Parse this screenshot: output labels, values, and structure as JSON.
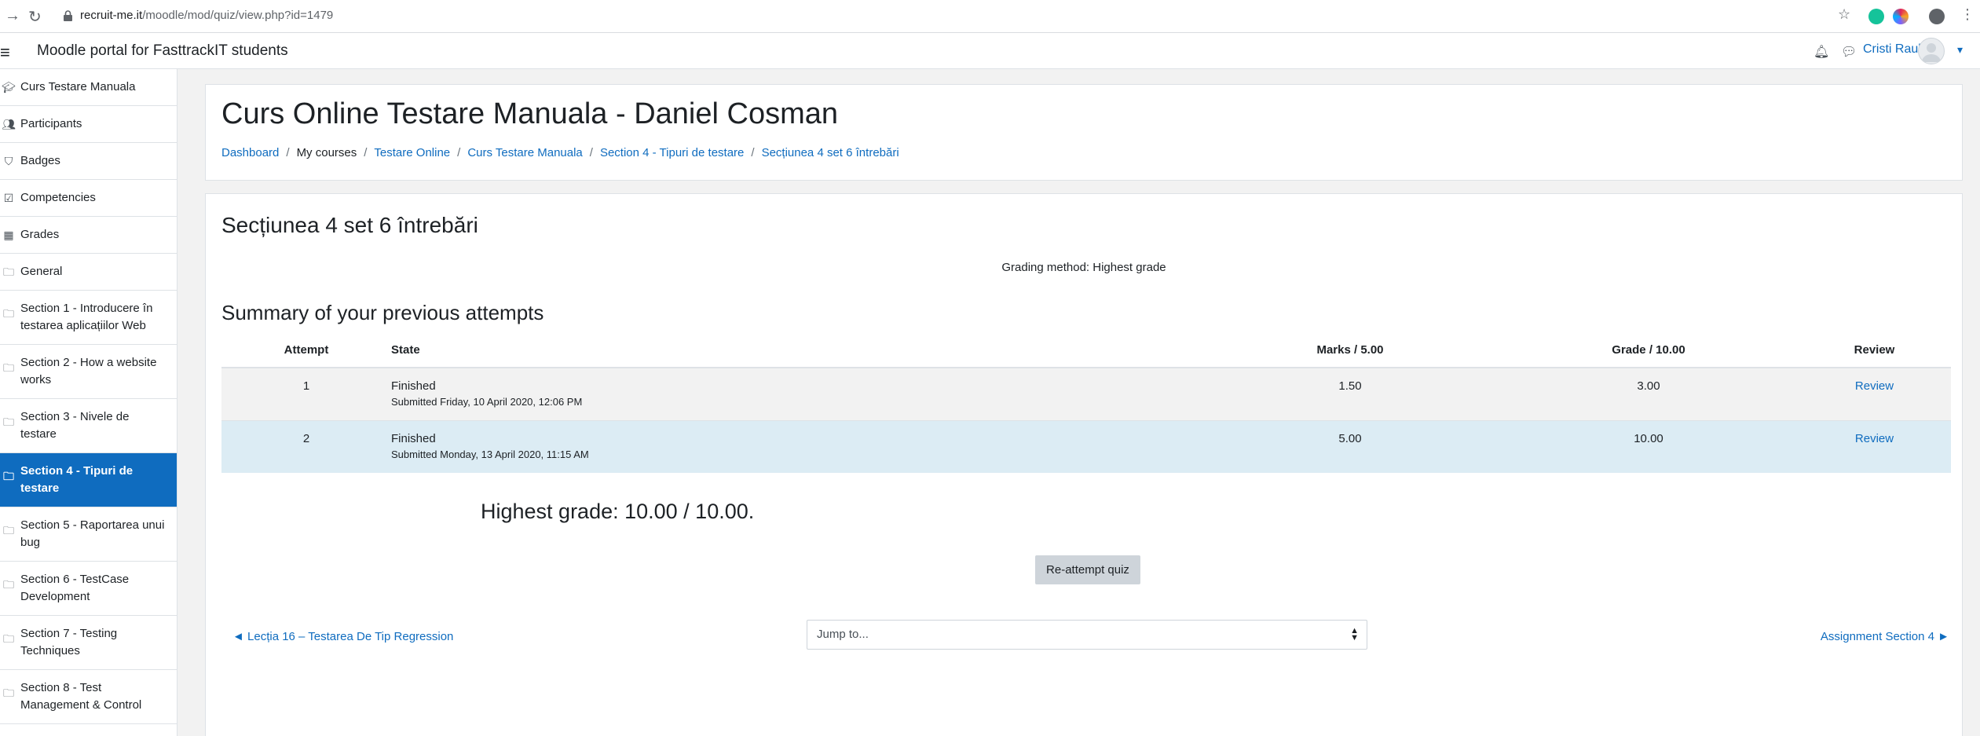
{
  "browser": {
    "url_host": "recruit-me.it",
    "url_path": "/moodle/mod/quiz/view.php?id=1479"
  },
  "navbar": {
    "site_name": "Moodle portal for FasttrackIT students",
    "user_name": "Cristi Raul"
  },
  "sidebar": {
    "items": [
      {
        "label": "Curs Testare Manuala",
        "icon": "graduation-cap-icon"
      },
      {
        "label": "Participants",
        "icon": "users-icon"
      },
      {
        "label": "Badges",
        "icon": "shield-icon"
      },
      {
        "label": "Competencies",
        "icon": "check-square-icon"
      },
      {
        "label": "Grades",
        "icon": "table-icon"
      },
      {
        "label": "General",
        "icon": "folder-icon"
      },
      {
        "label": "Section 1 - Introducere în testarea aplicațiilor Web",
        "icon": "folder-icon"
      },
      {
        "label": "Section 2 - How a website works",
        "icon": "folder-icon"
      },
      {
        "label": "Section 3 - Nivele de testare",
        "icon": "folder-icon"
      },
      {
        "label": "Section 4 - Tipuri de testare",
        "icon": "folder-icon",
        "active": true
      },
      {
        "label": "Section 5 - Raportarea unui bug",
        "icon": "folder-icon"
      },
      {
        "label": "Section 6 - TestCase Development",
        "icon": "folder-icon"
      },
      {
        "label": "Section 7 - Testing Techniques",
        "icon": "folder-icon"
      },
      {
        "label": "Section 8 - Test Management & Control",
        "icon": "folder-icon"
      }
    ]
  },
  "header": {
    "course_title": "Curs Online Testare Manuala - Daniel Cosman",
    "breadcrumb": [
      "Dashboard",
      "My courses",
      "Testare Online",
      "Curs Testare Manuala",
      "Section 4 - Tipuri de testare",
      "Secțiunea 4 set 6 întrebări"
    ]
  },
  "quiz": {
    "title": "Secțiunea 4 set 6 întrebări",
    "grading_method": "Grading method: Highest grade",
    "summary_title": "Summary of your previous attempts",
    "columns": [
      "Attempt",
      "State",
      "Marks / 5.00",
      "Grade / 10.00",
      "Review"
    ],
    "attempts": [
      {
        "attempt": "1",
        "state": "Finished",
        "submitted": "Submitted Friday, 10 April 2020, 12:06 PM",
        "marks": "1.50",
        "grade": "3.00",
        "review": "Review"
      },
      {
        "attempt": "2",
        "state": "Finished",
        "submitted": "Submitted Monday, 13 April 2020, 11:15 AM",
        "marks": "5.00",
        "grade": "10.00",
        "review": "Review"
      }
    ],
    "highest_grade": "Highest grade: 10.00 / 10.00.",
    "reattempt_label": "Re-attempt quiz",
    "prev_link": "◄ Lecția 16 – Testarea De Tip Regression",
    "jump_placeholder": "Jump to...",
    "next_link": "Assignment Section 4 ►"
  }
}
